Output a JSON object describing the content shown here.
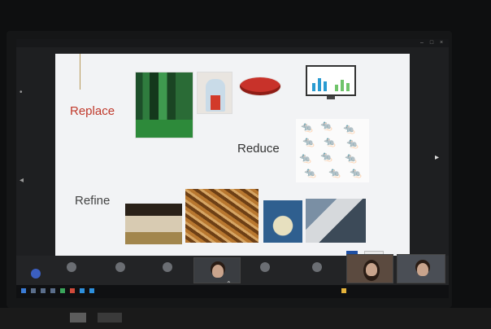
{
  "slide": {
    "labels": {
      "replace": "Replace",
      "reduce": "Reduce",
      "refine": "Refine"
    }
  },
  "call": {
    "participants_visible": 3
  },
  "colors": {
    "replace_label": "#c0392b",
    "taskbar": "#0f1012",
    "slide_background": "#f2f3f5"
  },
  "icons": [
    "minimize-icon",
    "maximize-icon",
    "close-icon",
    "chevron-up-icon"
  ]
}
